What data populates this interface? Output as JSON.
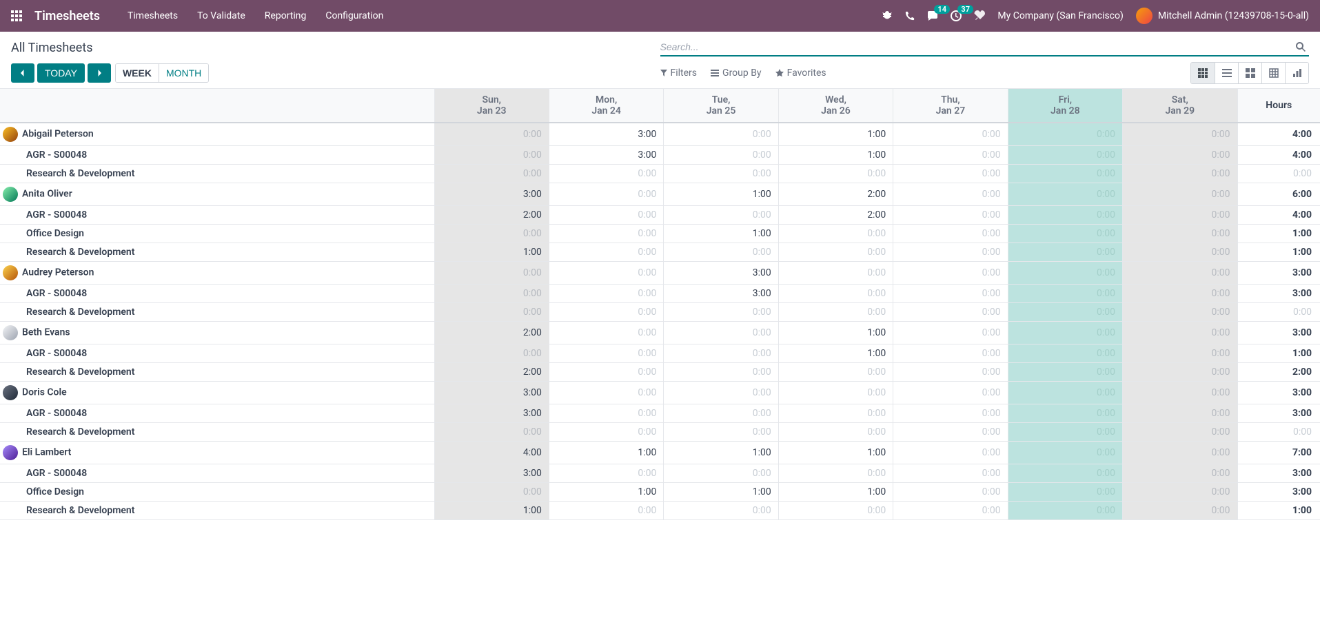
{
  "navbar": {
    "brand": "Timesheets",
    "menu": [
      "Timesheets",
      "To Validate",
      "Reporting",
      "Configuration"
    ],
    "msg_count": "14",
    "activity_count": "37",
    "company": "My Company (San Francisco)",
    "user": "Mitchell Admin (12439708-15-0-all)"
  },
  "cp": {
    "breadcrumb": "All Timesheets",
    "search_placeholder": "Search...",
    "today": "TODAY",
    "scale_week": "WEEK",
    "scale_month": "MONTH",
    "filters": "Filters",
    "groupby": "Group By",
    "favorites": "Favorites"
  },
  "days": [
    {
      "dow": "Sun,",
      "date": "Jan 23",
      "cls": "col-unavail"
    },
    {
      "dow": "Mon,",
      "date": "Jan 24",
      "cls": ""
    },
    {
      "dow": "Tue,",
      "date": "Jan 25",
      "cls": ""
    },
    {
      "dow": "Wed,",
      "date": "Jan 26",
      "cls": ""
    },
    {
      "dow": "Thu,",
      "date": "Jan 27",
      "cls": ""
    },
    {
      "dow": "Fri,",
      "date": "Jan 28",
      "cls": "col-today"
    },
    {
      "dow": "Sat,",
      "date": "Jan 29",
      "cls": "col-unavail"
    }
  ],
  "hours_label": "Hours",
  "rows": [
    {
      "label": "Abigail Peterson",
      "indent": 0,
      "avatar": "linear-gradient(135deg,#fbbf24,#92400e)",
      "cells": [
        "0:00",
        "3:00",
        "0:00",
        "1:00",
        "0:00",
        "0:00",
        "0:00"
      ],
      "total": "4:00"
    },
    {
      "label": "AGR - S00048",
      "indent": 1,
      "cells": [
        "0:00",
        "3:00",
        "0:00",
        "1:00",
        "0:00",
        "0:00",
        "0:00"
      ],
      "total": "4:00"
    },
    {
      "label": "Research & Development",
      "indent": 1,
      "cells": [
        "0:00",
        "0:00",
        "0:00",
        "0:00",
        "0:00",
        "0:00",
        "0:00"
      ],
      "total": "0:00"
    },
    {
      "label": "Anita Oliver",
      "indent": 0,
      "avatar": "linear-gradient(135deg,#86efac,#047857)",
      "cells": [
        "3:00",
        "0:00",
        "1:00",
        "2:00",
        "0:00",
        "0:00",
        "0:00"
      ],
      "total": "6:00"
    },
    {
      "label": "AGR - S00048",
      "indent": 1,
      "cells": [
        "2:00",
        "0:00",
        "0:00",
        "2:00",
        "0:00",
        "0:00",
        "0:00"
      ],
      "total": "4:00"
    },
    {
      "label": "Office Design",
      "indent": 1,
      "cells": [
        "0:00",
        "0:00",
        "1:00",
        "0:00",
        "0:00",
        "0:00",
        "0:00"
      ],
      "total": "1:00"
    },
    {
      "label": "Research & Development",
      "indent": 1,
      "cells": [
        "1:00",
        "0:00",
        "0:00",
        "0:00",
        "0:00",
        "0:00",
        "0:00"
      ],
      "total": "1:00"
    },
    {
      "label": "Audrey Peterson",
      "indent": 0,
      "avatar": "linear-gradient(135deg,#fcd34d,#b45309)",
      "cells": [
        "0:00",
        "0:00",
        "3:00",
        "0:00",
        "0:00",
        "0:00",
        "0:00"
      ],
      "total": "3:00"
    },
    {
      "label": "AGR - S00048",
      "indent": 1,
      "cells": [
        "0:00",
        "0:00",
        "3:00",
        "0:00",
        "0:00",
        "0:00",
        "0:00"
      ],
      "total": "3:00"
    },
    {
      "label": "Research & Development",
      "indent": 1,
      "cells": [
        "0:00",
        "0:00",
        "0:00",
        "0:00",
        "0:00",
        "0:00",
        "0:00"
      ],
      "total": "0:00"
    },
    {
      "label": "Beth Evans",
      "indent": 0,
      "avatar": "linear-gradient(135deg,#f3f4f6,#9ca3af)",
      "cells": [
        "2:00",
        "0:00",
        "0:00",
        "1:00",
        "0:00",
        "0:00",
        "0:00"
      ],
      "total": "3:00"
    },
    {
      "label": "AGR - S00048",
      "indent": 1,
      "cells": [
        "0:00",
        "0:00",
        "0:00",
        "1:00",
        "0:00",
        "0:00",
        "0:00"
      ],
      "total": "1:00"
    },
    {
      "label": "Research & Development",
      "indent": 1,
      "cells": [
        "2:00",
        "0:00",
        "0:00",
        "0:00",
        "0:00",
        "0:00",
        "0:00"
      ],
      "total": "2:00"
    },
    {
      "label": "Doris Cole",
      "indent": 0,
      "avatar": "linear-gradient(135deg,#6b7280,#1f2937)",
      "cells": [
        "3:00",
        "0:00",
        "0:00",
        "0:00",
        "0:00",
        "0:00",
        "0:00"
      ],
      "total": "3:00"
    },
    {
      "label": "AGR - S00048",
      "indent": 1,
      "cells": [
        "3:00",
        "0:00",
        "0:00",
        "0:00",
        "0:00",
        "0:00",
        "0:00"
      ],
      "total": "3:00"
    },
    {
      "label": "Research & Development",
      "indent": 1,
      "cells": [
        "0:00",
        "0:00",
        "0:00",
        "0:00",
        "0:00",
        "0:00",
        "0:00"
      ],
      "total": "0:00"
    },
    {
      "label": "Eli Lambert",
      "indent": 0,
      "avatar": "linear-gradient(135deg,#a78bfa,#4c1d95)",
      "cells": [
        "4:00",
        "1:00",
        "1:00",
        "1:00",
        "0:00",
        "0:00",
        "0:00"
      ],
      "total": "7:00"
    },
    {
      "label": "AGR - S00048",
      "indent": 1,
      "cells": [
        "3:00",
        "0:00",
        "0:00",
        "0:00",
        "0:00",
        "0:00",
        "0:00"
      ],
      "total": "3:00"
    },
    {
      "label": "Office Design",
      "indent": 1,
      "cells": [
        "0:00",
        "1:00",
        "1:00",
        "1:00",
        "0:00",
        "0:00",
        "0:00"
      ],
      "total": "3:00"
    },
    {
      "label": "Research & Development",
      "indent": 1,
      "cells": [
        "1:00",
        "0:00",
        "0:00",
        "0:00",
        "0:00",
        "0:00",
        "0:00"
      ],
      "total": "1:00"
    }
  ]
}
